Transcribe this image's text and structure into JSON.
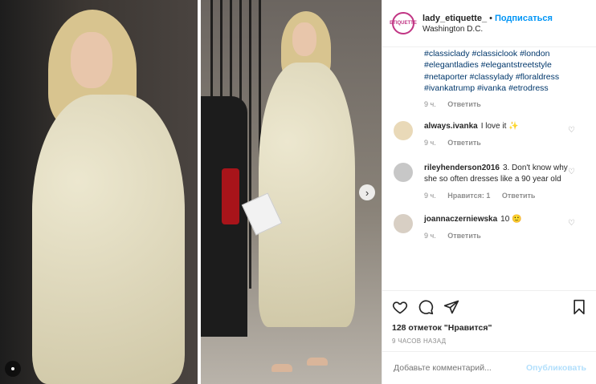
{
  "post": {
    "username": "lady_etiquette_",
    "separator": "•",
    "follow_label": "Подписаться",
    "location": "Washington D.C.",
    "avatar_text": "ETIQUETTE"
  },
  "caption": {
    "hashtags": [
      "#classiclady",
      "#classiclook",
      "#london",
      "#elegantladies",
      "#elegantstreetstyle",
      "#netaporter",
      "#classylady",
      "#floraldress",
      "#ivankatrump",
      "#ivanka",
      "#etrodress"
    ],
    "time": "9 ч.",
    "reply_label": "Ответить"
  },
  "comments": [
    {
      "user": "always.ivanka",
      "text": "I love it ✨",
      "time": "9 ч.",
      "likes": "",
      "reply": "Ответить",
      "avatar_color": "#e9d9b8"
    },
    {
      "user": "rileyhenderson2016",
      "text": "3. Don't know why she so often dresses like a 90 year old",
      "time": "9 ч.",
      "likes": "Нравится: 1",
      "reply": "Ответить",
      "avatar_color": "#c7c7c7"
    },
    {
      "user": "joannaczerniewska",
      "text": "10 🙂",
      "time": "9 ч.",
      "likes": "",
      "reply": "Ответить",
      "avatar_color": "#d8cfc4"
    }
  ],
  "actions": {
    "likes_text": "128 отметок \"Нравится\"",
    "time_ago": "9 ЧАСОВ НАЗАД"
  },
  "add_comment": {
    "placeholder": "Добавьте комментарий...",
    "publish_label": "Опубликовать"
  },
  "icons": {
    "heart": "heart-icon",
    "comment": "comment-icon",
    "share": "share-icon",
    "save": "bookmark-icon",
    "next": "chevron-right-icon",
    "more": "more-dots-icon"
  },
  "colors": {
    "link": "#00376b",
    "follow": "#0095f6",
    "muted": "#8e8e8e",
    "publish_disabled": "#b2dffc"
  }
}
